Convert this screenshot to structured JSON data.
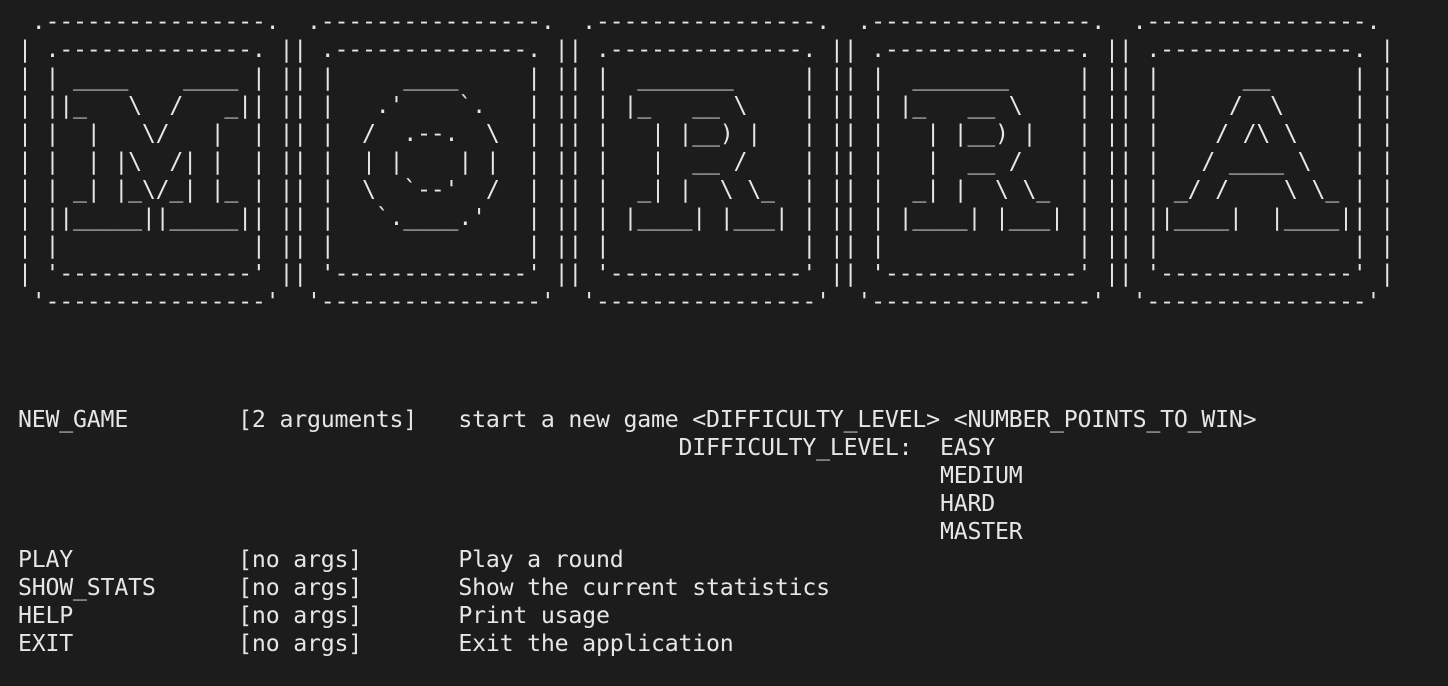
{
  "banner": {
    "title": "MORA",
    "letters": [
      "M",
      "O",
      "R",
      "R",
      "A"
    ],
    "ascii_lines": [
      " .----------------.  .----------------.  .----------------.  .----------------.  .----------------. ",
      "| .--------------. || .--------------. || .--------------. || .--------------. || .--------------. |",
      "| | ____    ____ | || |     ____     | || |  _______     | || |  _______     | || |      __      | |",
      "| ||_   \\  /   _|| || |   .'    `.   | || | |_   __ \\    | || | |_   __ \\    | || |     /  \\     | |",
      "| |  |   \\/   |  | || |  /  .--.  \\  | || |   | |__) |   | || |   | |__) |   | || |    / /\\ \\    | |",
      "| |  | |\\  /| |  | || |  | |    | |  | || |   |  __ /    | || |   |  __ /    | || |   / ____ \\   | |",
      "| | _| |_\\/_| |_ | || |  \\  `--'  /  | || |  _| |  \\ \\_  | || |  _| |  \\ \\_  | || | _/ /    \\ \\_ | |",
      "| ||_____||_____|| || |   `.____.'   | || | |____| |___| | || | |____| |___| | || ||____|  |____|| |",
      "| |              | || |              | || |              | || |              | || |              | |",
      "| '--------------' || '--------------' || '--------------' || '--------------' || '--------------' |",
      " '----------------'  '----------------'  '----------------'  '----------------'  '----------------' "
    ]
  },
  "commands": [
    {
      "name": "NEW_GAME",
      "args": "[2 arguments]",
      "description": "start a new game <DIFFICULTY_LEVEL> <NUMBER_POINTS_TO_WIN>"
    },
    {
      "name": "PLAY",
      "args": "[no args]",
      "description": "Play a round"
    },
    {
      "name": "SHOW_STATS",
      "args": "[no args]",
      "description": "Show the current statistics"
    },
    {
      "name": "HELP",
      "args": "[no args]",
      "description": "Print usage"
    },
    {
      "name": "EXIT",
      "args": "[no args]",
      "description": "Exit the application"
    }
  ],
  "difficulty": {
    "label": "DIFFICULTY_LEVEL:",
    "options": [
      "EASY",
      "MEDIUM",
      "HARD",
      "MASTER"
    ]
  },
  "colors": {
    "background": "#1c1c1c",
    "foreground": "#e6e6e6"
  }
}
